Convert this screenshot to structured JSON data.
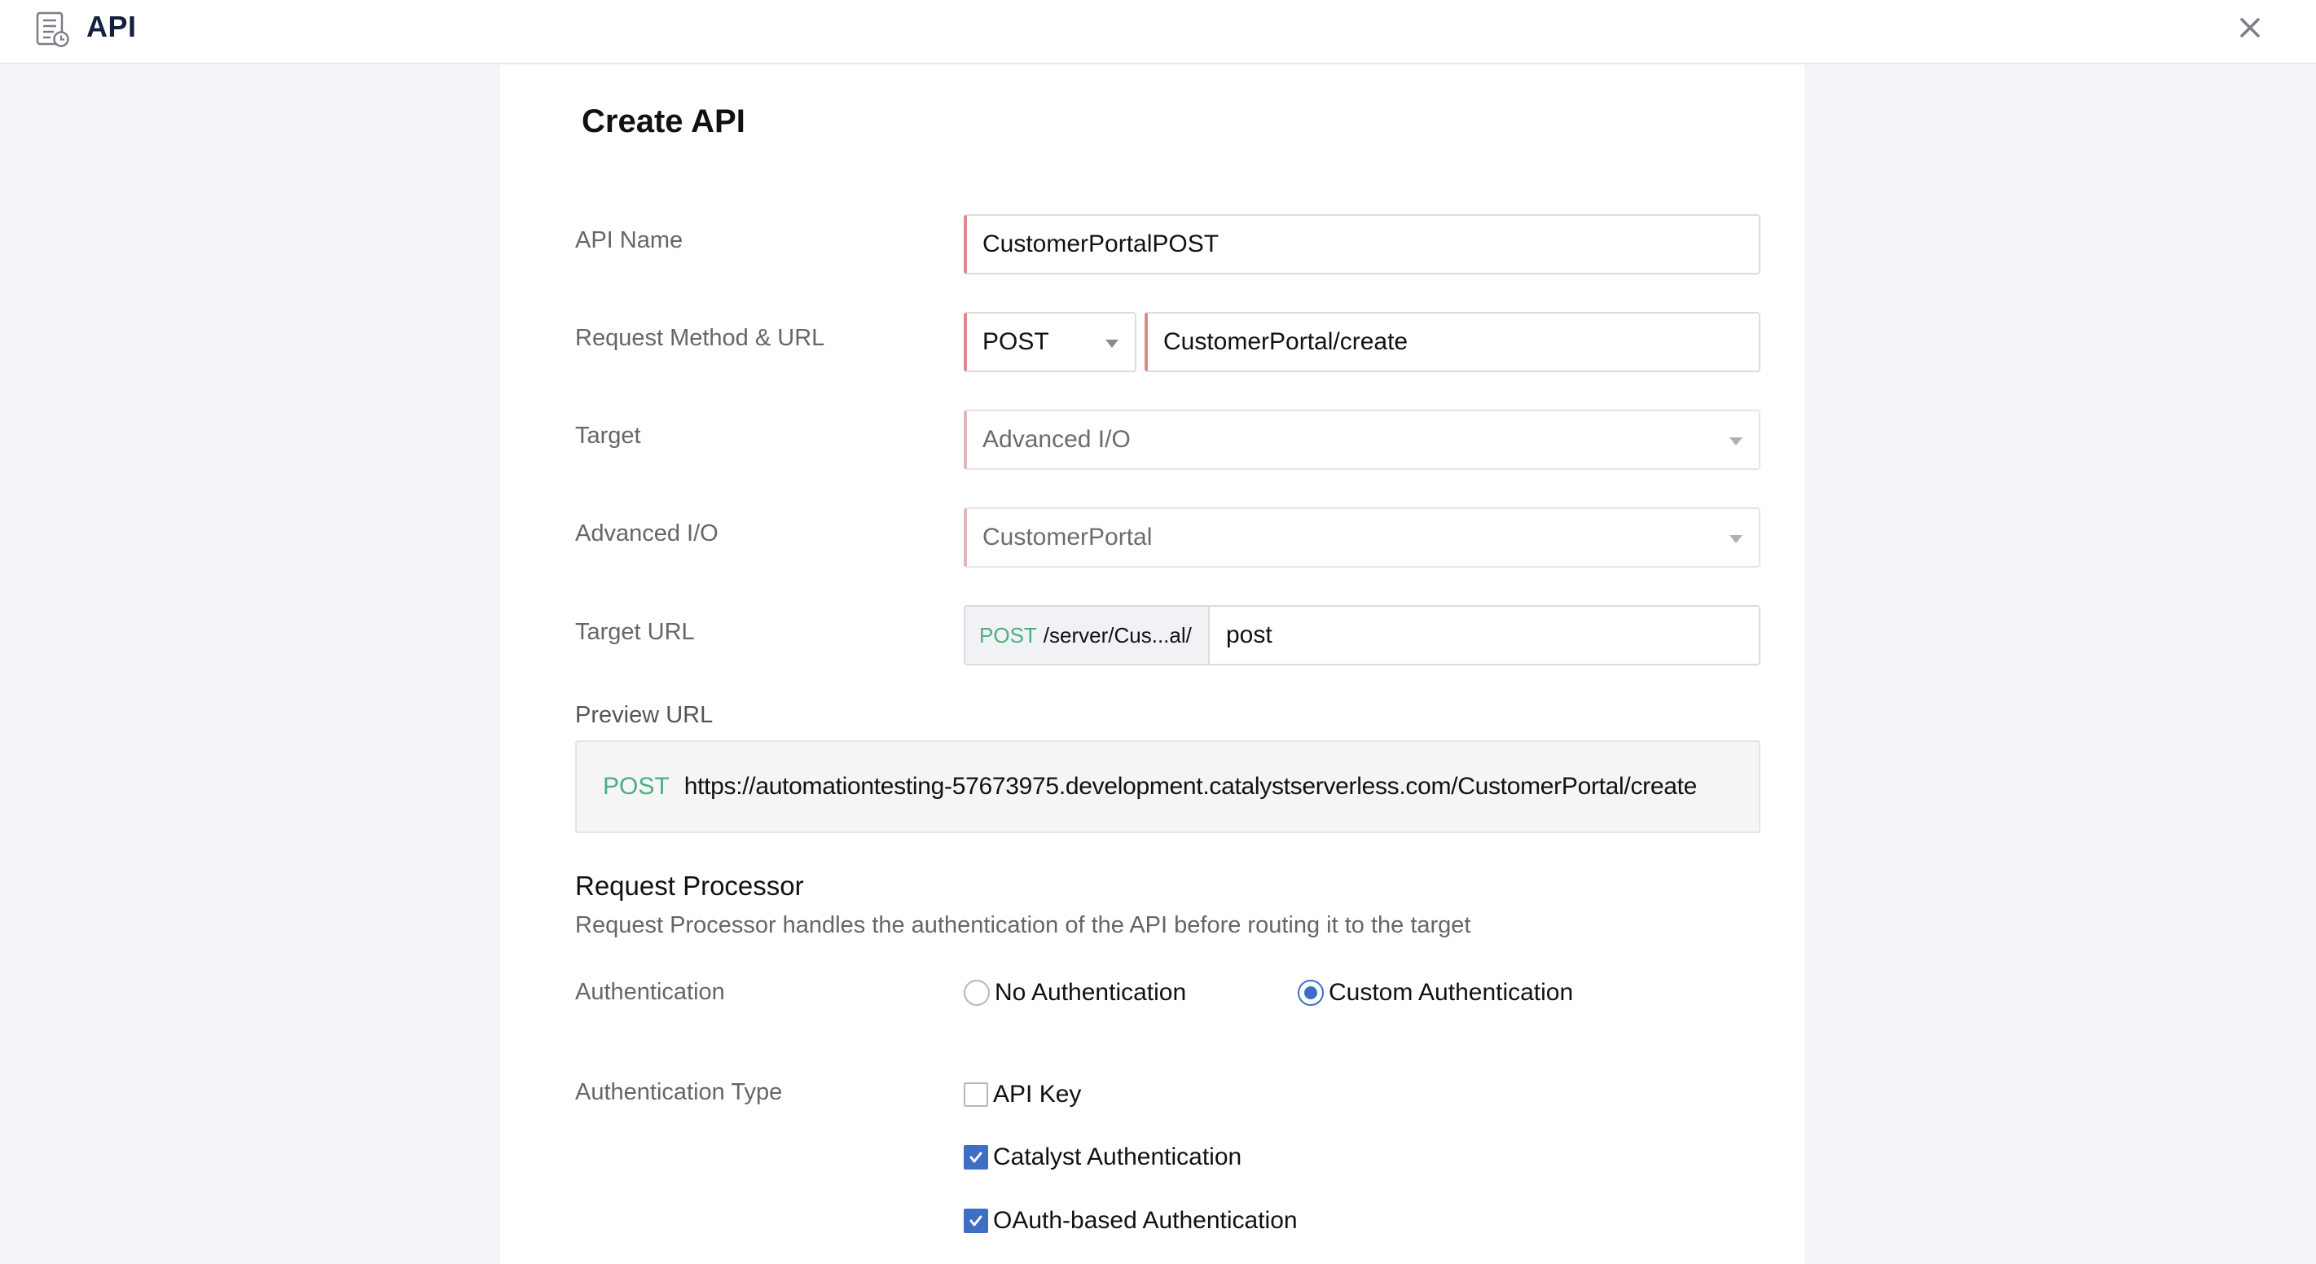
{
  "header": {
    "title": "API",
    "icon": "api-document-clock-icon",
    "close_icon": "close-icon"
  },
  "form": {
    "title": "Create API",
    "api_name": {
      "label": "API Name",
      "value": "CustomerPortalPOST"
    },
    "request_method_url": {
      "label": "Request Method & URL",
      "method": "POST",
      "url": "CustomerPortal/create"
    },
    "target": {
      "label": "Target",
      "value": "Advanced I/O"
    },
    "advanced_io": {
      "label": "Advanced I/O",
      "value": "CustomerPortal"
    },
    "target_url": {
      "label": "Target URL",
      "prefix_method": "POST",
      "prefix_path": "/server/Cus...al/",
      "value": "post"
    },
    "preview_url": {
      "label": "Preview URL",
      "method": "POST",
      "url": "https://automationtesting-57673975.development.catalystserverless.com/CustomerPortal/create"
    }
  },
  "request_processor": {
    "heading": "Request Processor",
    "description": "Request Processor handles the authentication of the API before routing it to the target",
    "authentication": {
      "label": "Authentication",
      "options": [
        {
          "label": "No Authentication",
          "selected": false
        },
        {
          "label": "Custom Authentication",
          "selected": true
        }
      ]
    },
    "authentication_type": {
      "label": "Authentication Type",
      "options": [
        {
          "label": "API Key",
          "checked": false
        },
        {
          "label": "Catalyst Authentication",
          "checked": true
        },
        {
          "label": "OAuth-based Authentication",
          "checked": true
        }
      ]
    }
  },
  "colors": {
    "accent": "#3e6fc4",
    "method_green": "#4caf7d",
    "required_border": "#d98b8b",
    "title_navy": "#14213d"
  }
}
